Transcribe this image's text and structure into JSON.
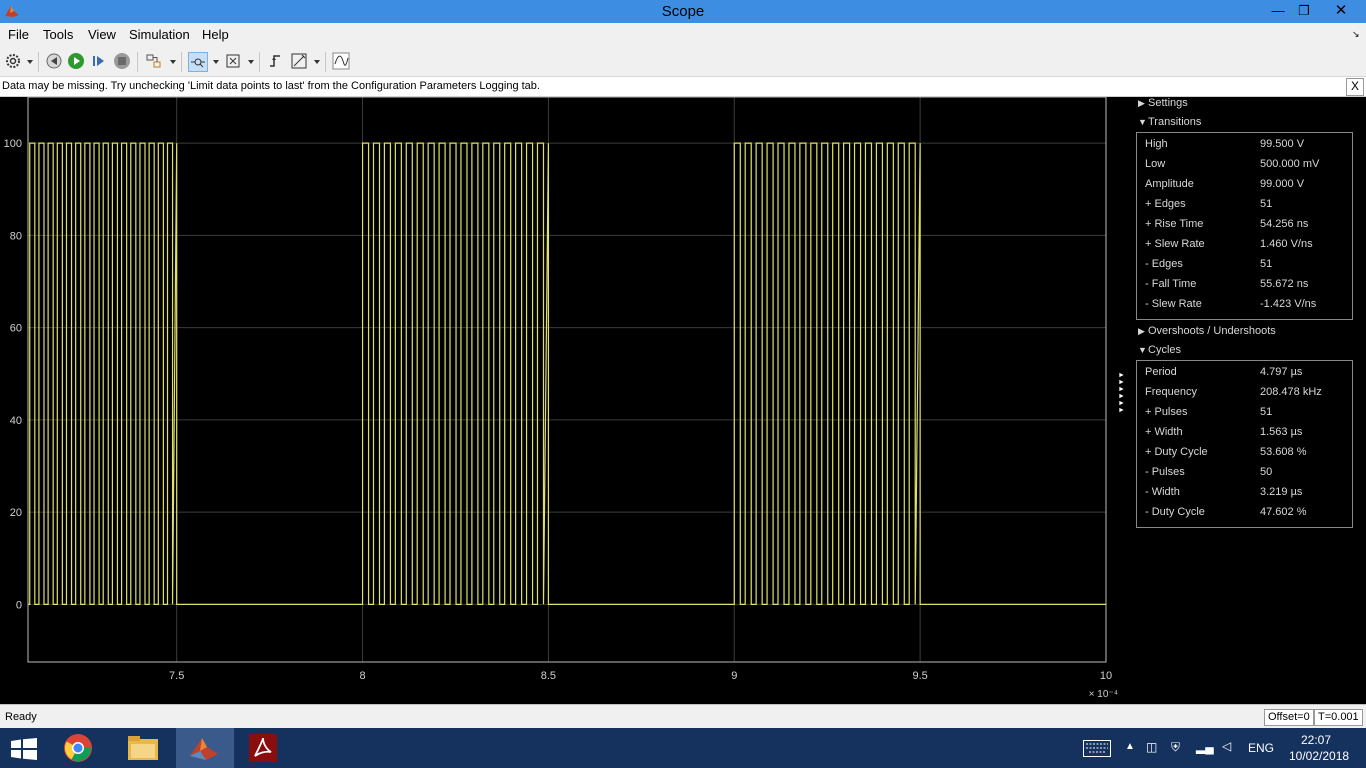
{
  "window": {
    "title": "Scope"
  },
  "menu": [
    "File",
    "Tools",
    "View",
    "Simulation",
    "Help"
  ],
  "info": {
    "message": "Data may be missing. Try unchecking 'Limit data points to last' from the Configuration Parameters Logging tab.",
    "close_label": "X"
  },
  "chart_data": {
    "type": "line",
    "xlim": [
      7.1,
      10
    ],
    "ylim": [
      -12.5,
      110
    ],
    "x_exponent": "× 10⁻⁴",
    "x_ticks": [
      7.5,
      8,
      8.5,
      9,
      9.5,
      10
    ],
    "x_tick_labels": [
      "7.5",
      "8",
      "8.5",
      "9",
      "9.5",
      "10"
    ],
    "y_ticks": [
      0,
      20,
      40,
      60,
      80,
      100
    ],
    "y_tick_labels": [
      "0",
      "20",
      "40",
      "60",
      "80",
      "100"
    ],
    "grid": true,
    "series": [
      {
        "color": "#e0e06a",
        "high": 100,
        "low": 0,
        "bursts": [
          {
            "start": 7.08,
            "end": 7.5,
            "pulse_count": 17
          },
          {
            "start": 8.0,
            "end": 8.5,
            "pulse_count": 17
          },
          {
            "start": 9.0,
            "end": 9.5,
            "pulse_count": 17
          }
        ]
      }
    ]
  },
  "panel": {
    "settings_label": "Settings",
    "transitions_label": "Transitions",
    "transitions": [
      {
        "label": "High",
        "value": "99.500 V"
      },
      {
        "label": "Low",
        "value": "500.000 mV"
      },
      {
        "label": "Amplitude",
        "value": "99.000 V"
      },
      {
        "label": "+ Edges",
        "value": "51"
      },
      {
        "label": "+ Rise Time",
        "value": "54.256 ns"
      },
      {
        "label": "+ Slew Rate",
        "value": "1.460 V/ns"
      },
      {
        "label": "- Edges",
        "value": "51"
      },
      {
        "label": "- Fall Time",
        "value": "55.672 ns"
      },
      {
        "label": "- Slew Rate",
        "value": "-1.423 V/ns"
      }
    ],
    "overshoots_label": "Overshoots / Undershoots",
    "cycles_label": "Cycles",
    "cycles": [
      {
        "label": "Period",
        "value": "4.797 µs"
      },
      {
        "label": "Frequency",
        "value": "208.478 kHz"
      },
      {
        "label": "+ Pulses",
        "value": "51"
      },
      {
        "label": "+ Width",
        "value": "1.563 µs"
      },
      {
        "label": "+ Duty Cycle",
        "value": "53.608 %"
      },
      {
        "label": "- Pulses",
        "value": "50"
      },
      {
        "label": "- Width",
        "value": "3.219 µs"
      },
      {
        "label": "- Duty Cycle",
        "value": "47.602 %"
      }
    ]
  },
  "status": {
    "ready": "Ready",
    "offset": "Offset=0",
    "time": "T=0.001"
  },
  "taskbar": {
    "lang": "ENG",
    "time": "22:07",
    "date": "10/02/2018"
  }
}
